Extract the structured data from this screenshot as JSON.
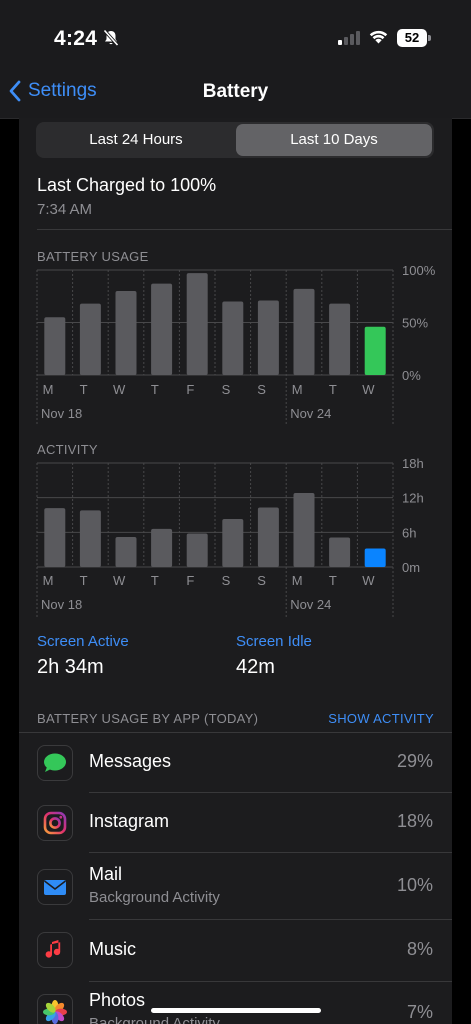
{
  "status": {
    "time": "4:24",
    "battery_level": "52"
  },
  "nav": {
    "back_label": "Settings",
    "title": "Battery"
  },
  "segment": {
    "option_1": "Last 24 Hours",
    "option_2": "Last 10 Days",
    "selected": "Last 10 Days"
  },
  "last_charged": {
    "title": "Last Charged to 100%",
    "time": "7:34 AM"
  },
  "battery_usage": {
    "header": "BATTERY USAGE",
    "y_ticks": [
      "100%",
      "50%",
      "0%"
    ],
    "day_labels": [
      "M",
      "T",
      "W",
      "T",
      "F",
      "S",
      "S",
      "M",
      "T",
      "W"
    ],
    "week_labels": [
      "Nov 18",
      "Nov 24"
    ]
  },
  "activity": {
    "header": "ACTIVITY",
    "y_ticks": [
      "18h",
      "12h",
      "6h",
      "0m"
    ],
    "day_labels": [
      "M",
      "T",
      "W",
      "T",
      "F",
      "S",
      "S",
      "M",
      "T",
      "W"
    ],
    "week_labels": [
      "Nov 18",
      "Nov 24"
    ]
  },
  "screen": {
    "active_label": "Screen Active",
    "active_value": "2h 34m",
    "idle_label": "Screen Idle",
    "idle_value": "42m"
  },
  "apps_section": {
    "header": "BATTERY USAGE BY APP (TODAY)",
    "action": "SHOW ACTIVITY"
  },
  "apps": [
    {
      "name": "Messages",
      "sub": "",
      "pct": "29%",
      "icon": "messages-icon"
    },
    {
      "name": "Instagram",
      "sub": "",
      "pct": "18%",
      "icon": "instagram-icon"
    },
    {
      "name": "Mail",
      "sub": "Background Activity",
      "pct": "10%",
      "icon": "mail-icon"
    },
    {
      "name": "Music",
      "sub": "",
      "pct": "8%",
      "icon": "music-icon"
    },
    {
      "name": "Photos",
      "sub": "Background Activity",
      "pct": "7%",
      "icon": "photos-icon"
    }
  ],
  "colors": {
    "accent": "#3e8ef7",
    "bar": "#5a5a5e",
    "battery_today": "#34c759",
    "activity_today": "#0a84ff"
  },
  "chart_data": [
    {
      "type": "bar",
      "title": "BATTERY USAGE",
      "categories": [
        "M",
        "T",
        "W",
        "T",
        "F",
        "S",
        "S",
        "M",
        "T",
        "W"
      ],
      "values": [
        55,
        68,
        80,
        87,
        97,
        70,
        71,
        82,
        68,
        46
      ],
      "ylim": [
        0,
        100
      ],
      "ytick_labels": [
        "0%",
        "50%",
        "100%"
      ]
    },
    {
      "type": "bar",
      "title": "ACTIVITY",
      "categories": [
        "M",
        "T",
        "W",
        "T",
        "F",
        "S",
        "S",
        "M",
        "T",
        "W"
      ],
      "values": [
        10.2,
        9.8,
        5.2,
        6.6,
        5.8,
        8.3,
        10.3,
        12.8,
        5.1,
        3.2
      ],
      "unit": "hours",
      "ylim": [
        0,
        18
      ],
      "ytick_labels": [
        "0m",
        "6h",
        "12h",
        "18h"
      ]
    }
  ]
}
